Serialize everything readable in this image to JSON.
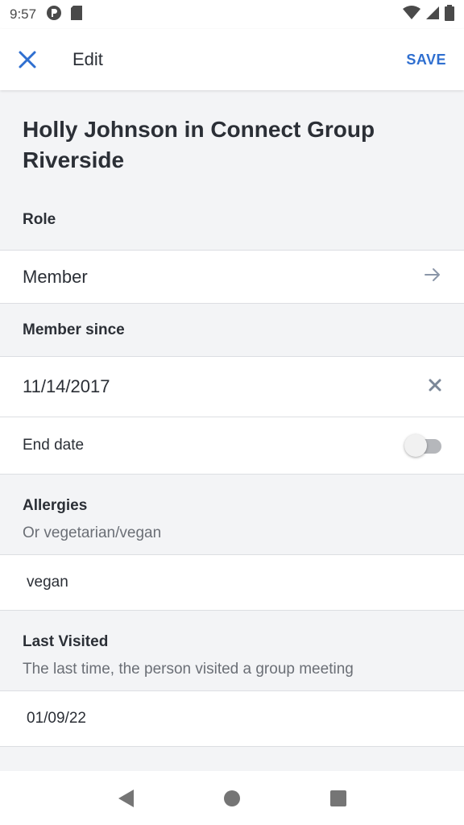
{
  "status_bar": {
    "time": "9:57"
  },
  "app_bar": {
    "title": "Edit",
    "save_label": "SAVE"
  },
  "heading": "Holly Johnson in Connect Group Riverside",
  "role": {
    "label": "Role",
    "value": "Member"
  },
  "member_since": {
    "label": "Member since",
    "value": "11/14/2017"
  },
  "end_date": {
    "label": "End date",
    "enabled": false
  },
  "allergies": {
    "label": "Allergies",
    "hint": "Or vegetarian/vegan",
    "value": "vegan"
  },
  "last_visited": {
    "label": "Last Visited",
    "hint": "The last time, the person visited a group meeting",
    "value": "01/09/22"
  },
  "colors": {
    "accent": "#2f6fd0",
    "background": "#f3f4f6",
    "text": "#2b2f36",
    "muted": "#6b6f76"
  }
}
